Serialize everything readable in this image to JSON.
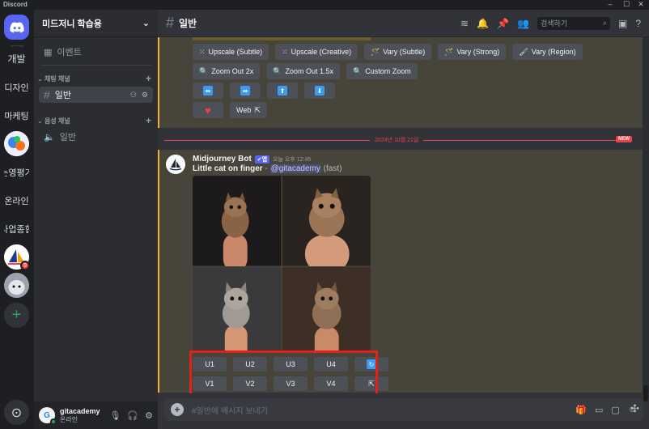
{
  "window": {
    "app_name": "Discord",
    "minimize": "–",
    "maximize": "☐",
    "close": "✕"
  },
  "servers": [
    {
      "name": "discord-home",
      "label": ""
    },
    {
      "name": "server-dev",
      "label": "개발"
    },
    {
      "name": "server-design",
      "label": "디자인"
    },
    {
      "name": "server-marketing",
      "label": "마케팅"
    },
    {
      "name": "server-logo",
      "label": ""
    },
    {
      "name": "server-management",
      "label": "는영평가"
    },
    {
      "name": "server-online",
      "label": "온라인"
    },
    {
      "name": "server-business",
      "label": "사업종합"
    },
    {
      "name": "server-gitacademy",
      "label": "",
      "badge": "9"
    },
    {
      "name": "server-cat",
      "label": ""
    }
  ],
  "add_server": "+",
  "discover": "⊙",
  "sidebar": {
    "guild_name": "미드저니 학습용",
    "events": "이벤트",
    "text_category": "채팅 채널",
    "text_channel": "일반",
    "voice_category": "음성 채널",
    "voice_channel": "일반"
  },
  "user": {
    "name": "gitacademy",
    "status": "온라인"
  },
  "header": {
    "channel": "일반",
    "search_placeholder": "검색하기"
  },
  "prev_message": {
    "row1": [
      "Upscale (Subtle)",
      "Upscale (Creative)",
      "Vary (Subtle)",
      "Vary (Strong)",
      "Vary (Region)"
    ],
    "row2": [
      "Zoom Out 2x",
      "Zoom Out 1.5x",
      "Custom Zoom"
    ],
    "arrows": [
      "⬅",
      "➡",
      "⬆",
      "⬇"
    ],
    "web": "Web"
  },
  "date_divider": "2024년 10월 21일",
  "new_badge": "NEW",
  "message": {
    "author": "Midjourney Bot",
    "bot_tag": "✔앱",
    "time": "오늘 오후 12:45",
    "prompt": "Little cat on finger",
    "separator": " - ",
    "mention": "@gitacademy",
    "mode": "(fast)",
    "upscale": [
      "U1",
      "U2",
      "U3",
      "U4"
    ],
    "variation": [
      "V1",
      "V2",
      "V3",
      "V4"
    ],
    "reroll_icon": "↻",
    "open_icon": "⇱"
  },
  "composer": {
    "placeholder": "#일반에 메시지 보내기"
  }
}
